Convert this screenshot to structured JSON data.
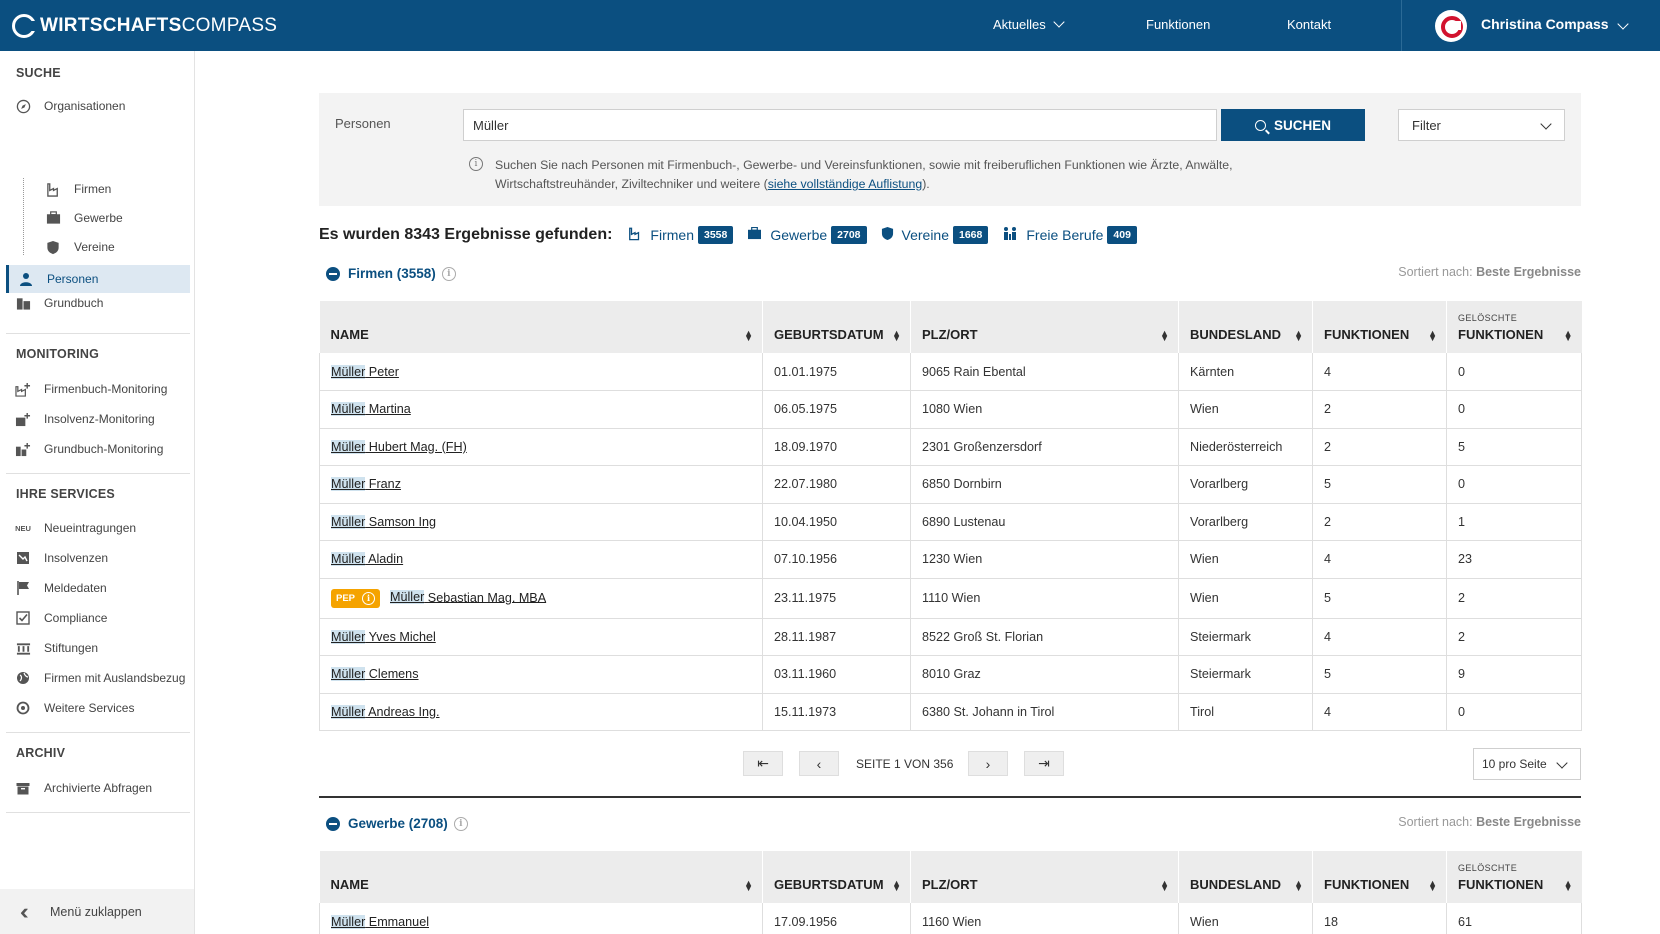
{
  "app": {
    "logo_bold": "WIRTSCHAFTS",
    "logo_light": "COMPASS"
  },
  "nav": {
    "aktuelles": "Aktuelles",
    "funktionen": "Funktionen",
    "kontakt": "Kontakt"
  },
  "user": {
    "name": "Christina Compass"
  },
  "sidebar": {
    "suche_head": "SUCHE",
    "organisationen": "Organisationen",
    "firmen": "Firmen",
    "gewerbe": "Gewerbe",
    "vereine": "Vereine",
    "personen": "Personen",
    "grundbuch": "Grundbuch",
    "monitoring_head": "MONITORING",
    "firmenbuch_monitoring": "Firmenbuch-Monitoring",
    "insolvenz_monitoring": "Insolvenz-Monitoring",
    "grundbuch_monitoring": "Grundbuch-Monitoring",
    "services_head": "IHRE SERVICES",
    "neu_tag": "NEU",
    "neueintragungen": "Neueintragungen",
    "insolvenzen": "Insolvenzen",
    "meldedaten": "Meldedaten",
    "compliance": "Compliance",
    "stiftungen": "Stiftungen",
    "auslandsbezug": "Firmen mit Auslandsbezug",
    "weitere": "Weitere Services",
    "archiv_head": "ARCHIV",
    "archivierte": "Archivierte Abfragen",
    "collapse": "Menü zuklappen"
  },
  "search": {
    "label": "Personen",
    "value": "Müller",
    "button": "SUCHEN",
    "filter": "Filter",
    "hint_text": "Suchen Sie nach Personen mit Firmenbuch-, Gewerbe- und Vereinsfunktionen, sowie mit freiberuflichen Funktionen wie Ärzte, Anwälte, Wirtschaftstreuhänder, Ziviltechniker und weitere (",
    "hint_link": "siehe vollständige Auflistung",
    "hint_end": ")."
  },
  "results": {
    "title": "Es wurden 8343 Ergebnisse gefunden:",
    "firmen_label": "Firmen",
    "firmen_count": "3558",
    "gewerbe_label": "Gewerbe",
    "gewerbe_count": "2708",
    "vereine_label": "Vereine",
    "vereine_count": "1668",
    "freie_label": "Freie Berufe",
    "freie_count": "409"
  },
  "sort": {
    "prefix": "Sortiert nach:",
    "value": "Beste Ergebnisse"
  },
  "columns": {
    "name": "NAME",
    "geburtsdatum": "GEBURTSDATUM",
    "plz": "PLZ/ORT",
    "bundesland": "BUNDESLAND",
    "funktionen": "FUNKTIONEN",
    "geloeschte_small": "GELÖSCHTE",
    "geloeschte": "FUNKTIONEN"
  },
  "firmen_section": {
    "title": "Firmen (3558)",
    "rows": [
      {
        "hl": "Müller",
        "rest": " Peter",
        "date": "01.01.1975",
        "plz": "9065 Rain Ebental",
        "land": "Kärnten",
        "f": "4",
        "g": "0"
      },
      {
        "hl": "Müller",
        "rest": " Martina",
        "date": "06.05.1975",
        "plz": "1080 Wien",
        "land": "Wien",
        "f": "2",
        "g": "0"
      },
      {
        "hl": "Müller",
        "rest": " Hubert Mag. (FH)",
        "date": "18.09.1970",
        "plz": "2301 Großenzersdorf",
        "land": "Niederösterreich",
        "f": "2",
        "g": "5"
      },
      {
        "hl": "Müller",
        "rest": " Franz",
        "date": "22.07.1980",
        "plz": "6850 Dornbirn",
        "land": "Vorarlberg",
        "f": "5",
        "g": "0"
      },
      {
        "hl": "Müller",
        "rest": " Samson Ing",
        "date": "10.04.1950",
        "plz": "6890 Lustenau",
        "land": "Vorarlberg",
        "f": "2",
        "g": "1"
      },
      {
        "hl": "Müller",
        "rest": " Aladin",
        "date": "07.10.1956",
        "plz": "1230 Wien",
        "land": "Wien",
        "f": "4",
        "g": "23"
      },
      {
        "pep": "PEP",
        "hl": "Müller",
        "rest": " Sebastian Mag. MBA",
        "date": "23.11.1975",
        "plz": "1110 Wien",
        "land": "Wien",
        "f": "5",
        "g": "2"
      },
      {
        "hl": "Müller",
        "rest": " Yves Michel",
        "date": "28.11.1987",
        "plz": "8522 Groß St. Florian",
        "land": "Steiermark",
        "f": "4",
        "g": "2"
      },
      {
        "hl": "Müller",
        "rest": " Clemens",
        "date": "03.11.1960",
        "plz": "8010 Graz",
        "land": "Steiermark",
        "f": "5",
        "g": "9"
      },
      {
        "hl": "Müller",
        "rest": " Andreas Ing.",
        "date": "15.11.1973",
        "plz": "6380 St. Johann in Tirol",
        "land": "Tirol",
        "f": "4",
        "g": "0"
      }
    ]
  },
  "pager": {
    "text": "SEITE 1 VON 356",
    "perpage": "10 pro Seite"
  },
  "gewerbe_section": {
    "title": "Gewerbe (2708)",
    "rows": [
      {
        "hl": "Müller",
        "rest": " Emmanuel",
        "date": "17.09.1956",
        "plz": "1160 Wien",
        "land": "Wien",
        "f": "18",
        "g": "61"
      }
    ]
  }
}
